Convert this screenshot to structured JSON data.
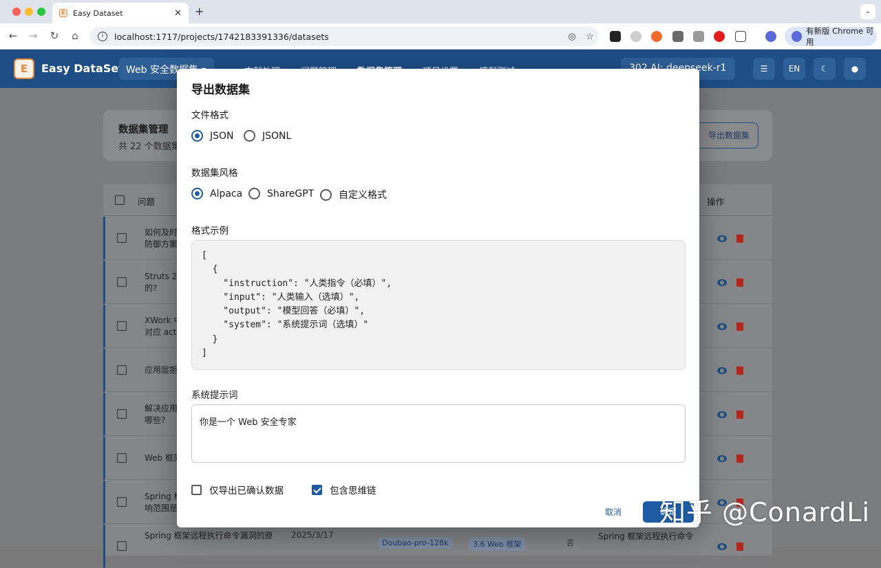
{
  "browser": {
    "tab_title": "Easy Dataset",
    "tab_favicon": "E",
    "url": "localhost:1717/projects/1742183391336/datasets",
    "update_label": "有新版 Chrome 可用"
  },
  "appbar": {
    "app_name": "Easy DataSet",
    "logo_letter": "E",
    "project": "Web 安全数据集 ▾",
    "nav": [
      "文献处理",
      "问题管理",
      "数据集管理",
      "项目设置",
      "模型测试"
    ],
    "model": "302 AI: deepseek-r1 ▾",
    "lang": "EN"
  },
  "page": {
    "title": "数据集管理",
    "subtitle": "共 22 个数据集",
    "export_label": "导出数据集",
    "col_question": "问题",
    "col_actions": "操作",
    "rows": [
      [
        "如何及时…",
        "防御方案?"
      ],
      [
        "Struts 2 …",
        "的?"
      ],
      [
        "XWork 中…",
        "对应 action"
      ],
      [
        "应用层拒绝…",
        ""
      ],
      [
        "解决应用…",
        "哪些?"
      ],
      [
        "Web 框架…",
        ""
      ],
      [
        "Spring 框…",
        "响范围是…"
      ],
      [
        "Spring 框架远程执行命令漏洞的原",
        ""
      ]
    ],
    "last_row": {
      "date": "2025/3/17",
      "model": "Doubao-pro-128k",
      "chapter": "3.6 Web 框架",
      "flag": "否",
      "answer": "Spring 框架远程执行命令"
    }
  },
  "modal": {
    "title": "导出数据集",
    "file_format_label": "文件格式",
    "formats": [
      "JSON",
      "JSONL"
    ],
    "selected_format": "JSON",
    "style_label": "数据集风格",
    "styles": [
      "Alpaca",
      "ShareGPT",
      "自定义格式"
    ],
    "selected_style": "Alpaca",
    "example_label": "格式示例",
    "example_code": "[\n  {\n    \"instruction\": \"人类指令（必填）\",\n    \"input\": \"人类输入（选填）\",\n    \"output\": \"模型回答（必填）\",\n    \"system\": \"系统提示词（选填）\"\n  }\n]",
    "system_prompt_label": "系统提示词",
    "system_prompt_value": "你是一个 Web 安全专家",
    "confirmed_only_label": "仅导出已确认数据",
    "confirmed_only": false,
    "include_cot_label": "包含思维链",
    "include_cot": true,
    "cancel_label": "取消",
    "confirm_label": "确定"
  },
  "watermark": "知乎 @ConardLi",
  "colors": {
    "appbar": "#1e4d86",
    "primary": "#1e5ba3",
    "delete": "#b3261e"
  }
}
